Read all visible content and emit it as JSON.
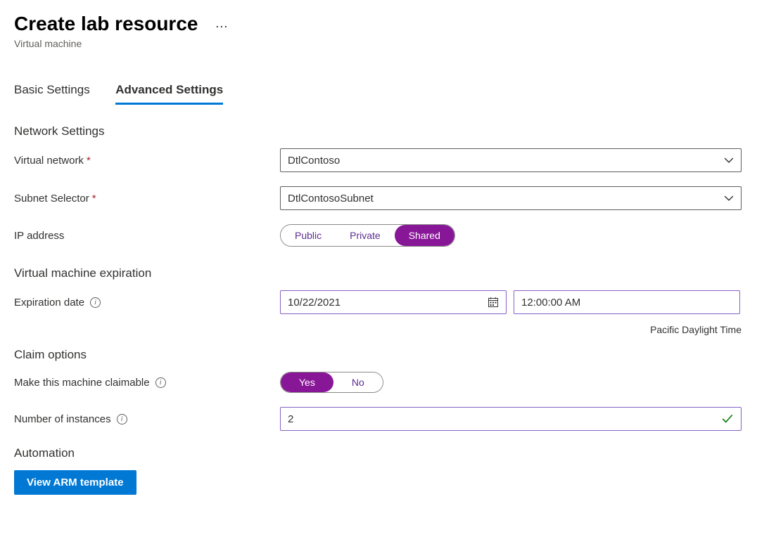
{
  "header": {
    "title": "Create lab resource",
    "subtitle": "Virtual machine",
    "ellipsis": "⋯"
  },
  "tabs": {
    "basic": "Basic Settings",
    "advanced": "Advanced Settings"
  },
  "network": {
    "heading": "Network Settings",
    "vnet_label": "Virtual network",
    "vnet_value": "DtlContoso",
    "subnet_label": "Subnet Selector",
    "subnet_value": "DtlContosoSubnet",
    "ip_label": "IP address",
    "ip_options": {
      "public": "Public",
      "private": "Private",
      "shared": "Shared"
    }
  },
  "expiration": {
    "heading": "Virtual machine expiration",
    "date_label": "Expiration date",
    "date_value": "10/22/2021",
    "time_value": "12:00:00 AM",
    "timezone": "Pacific Daylight Time"
  },
  "claim": {
    "heading": "Claim options",
    "claimable_label": "Make this machine claimable",
    "options": {
      "yes": "Yes",
      "no": "No"
    },
    "instances_label": "Number of instances",
    "instances_value": "2"
  },
  "automation": {
    "heading": "Automation",
    "button": "View ARM template"
  }
}
